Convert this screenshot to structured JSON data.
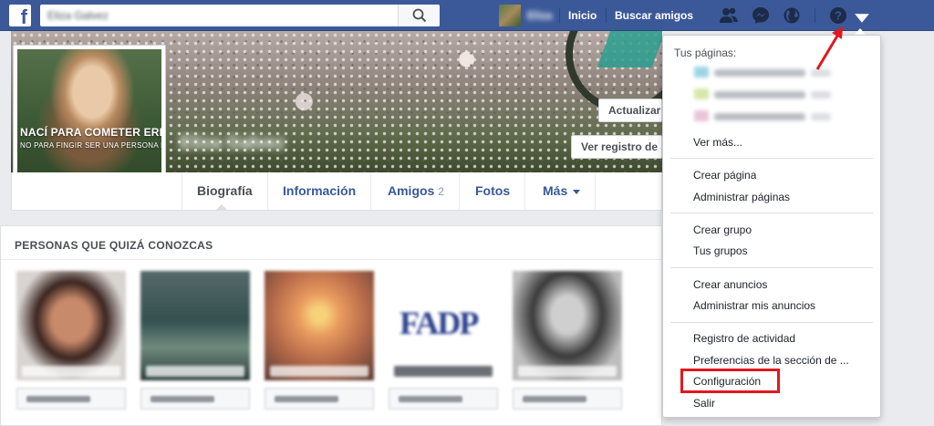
{
  "header": {
    "search_placeholder": "Eliza Galvez",
    "username": "Eliza",
    "nav_home": "Inicio",
    "nav_find_friends": "Buscar amigos"
  },
  "cover": {
    "name": "Eliza Galvez",
    "update_button": "Actualizar",
    "activity_button": "Ver registro de actividad"
  },
  "profile": {
    "line1": "NACÍ PARA COMETER ERRORES",
    "line2": "NO PARA FINGIR SER UNA PERSONA PERFECTA"
  },
  "tabs": {
    "timeline": "Biografía",
    "about": "Información",
    "friends": "Amigos",
    "friends_count": "2",
    "photos": "Fotos",
    "more": "Más"
  },
  "pymk": {
    "title": "PERSONAS QUE QUIZÁ CONOZCAS",
    "cards": [
      {
        "name": "Jessica Jaser",
        "button": "Añadir a mis amigos"
      },
      {
        "name": "Daniel Meza",
        "button": "Añadir a mis amigos"
      },
      {
        "name": "Orlando Sanchez",
        "button": "Añadir a mis amigos"
      },
      {
        "name": "Facultad de Arquitectura",
        "button": "Añadir a mis amigos"
      },
      {
        "name": "Edgar Perez",
        "button": "Añadir a mis amigos"
      }
    ],
    "fadp_logo": "FADP"
  },
  "menu": {
    "your_pages": "Tus páginas:",
    "pages": [
      {
        "name": "Mirsa Fotos",
        "count": "20"
      },
      {
        "name": "Frases bonitas",
        "count": "20"
      },
      {
        "name": "Social Rd",
        "count": "20"
      }
    ],
    "see_more": "Ver más...",
    "create_page": "Crear página",
    "manage_pages": "Administrar páginas",
    "create_group": "Crear grupo",
    "your_groups": "Tus grupos",
    "create_ads": "Crear anuncios",
    "manage_ads": "Administrar mis anuncios",
    "activity_log": "Registro de actividad",
    "news_feed_prefs": "Preferencias de la sección de ...",
    "settings": "Configuración",
    "logout": "Salir"
  },
  "colors": {
    "brand_blue": "#3b5998",
    "link_blue": "#365899",
    "highlight_red": "#e0191f"
  }
}
